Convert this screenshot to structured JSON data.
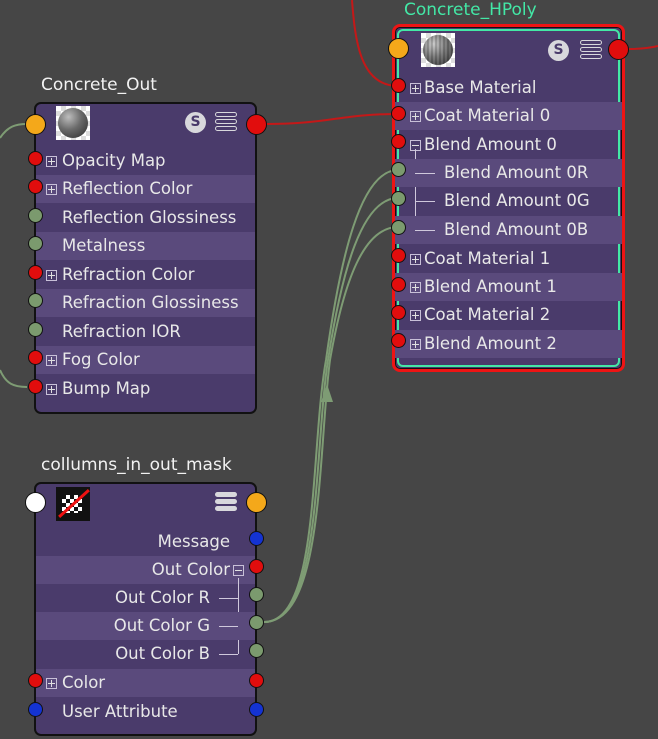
{
  "nodes": {
    "concrete_out": {
      "title": "Concrete_Out",
      "attributes": [
        {
          "label": "Opacity Map",
          "expander": "plus",
          "plug": "red"
        },
        {
          "label": "Reflection Color",
          "expander": "plus",
          "plug": "red"
        },
        {
          "label": "Reflection Glossiness",
          "expander": "",
          "plug": "green"
        },
        {
          "label": "Metalness",
          "expander": "",
          "plug": "green"
        },
        {
          "label": "Refraction Color",
          "expander": "plus",
          "plug": "red"
        },
        {
          "label": "Refraction Glossiness",
          "expander": "",
          "plug": "green"
        },
        {
          "label": "Refraction IOR",
          "expander": "",
          "plug": "green"
        },
        {
          "label": "Fog Color",
          "expander": "plus",
          "plug": "red"
        },
        {
          "label": "Bump Map",
          "expander": "plus",
          "plug": "red"
        }
      ],
      "header_icons": [
        "material-sphere-icon",
        "s-icon",
        "menu-icon"
      ]
    },
    "concrete_hpoly": {
      "title": "Concrete_HPoly",
      "attributes": [
        {
          "label": "Base Material",
          "expander": "plus",
          "plug": "red"
        },
        {
          "label": "Coat Material 0",
          "expander": "plus",
          "plug": "red"
        },
        {
          "label": "Blend Amount 0",
          "expander": "minus",
          "plug": "red"
        },
        {
          "label": "Blend Amount 0R",
          "expander": "",
          "plug": "green"
        },
        {
          "label": "Blend Amount 0G",
          "expander": "",
          "plug": "green"
        },
        {
          "label": "Blend Amount 0B",
          "expander": "",
          "plug": "green"
        },
        {
          "label": "Coat Material 1",
          "expander": "plus",
          "plug": "red"
        },
        {
          "label": "Blend Amount 1",
          "expander": "plus",
          "plug": "red"
        },
        {
          "label": "Coat Material 2",
          "expander": "plus",
          "plug": "red"
        },
        {
          "label": "Blend Amount 2",
          "expander": "plus",
          "plug": "red"
        }
      ],
      "header_icons": [
        "material-sphere-icon",
        "s-icon",
        "menu-icon"
      ]
    },
    "columns_mask": {
      "title": "collumns_in_out_mask",
      "attributes": [
        {
          "label": "Message",
          "plug": "blue"
        },
        {
          "label": "Out Color",
          "plug": "red"
        },
        {
          "label": "Out Color R",
          "plug": "green"
        },
        {
          "label": "Out Color G",
          "plug": "green"
        },
        {
          "label": "Out Color B",
          "plug": "green"
        },
        {
          "label": "Color",
          "plug": "red"
        },
        {
          "label": "User Attribute",
          "plug": "blue"
        }
      ],
      "header_icons": [
        "file-texture-icon",
        "menu-icon"
      ]
    }
  },
  "colors": {
    "background": "#464646",
    "node_body": "#4a3b6b",
    "node_row_alt": "#5a4a7c",
    "selected_title": "#43e8a6",
    "selection_outer": "#ee1414",
    "plug_red": "#e10d0d",
    "plug_green": "#7b9a6e",
    "plug_blue": "#1433d2",
    "plug_orange": "#f4a81a",
    "wire_red": "#c41818",
    "wire_green": "#7e9c74"
  },
  "s_icon_label": "S"
}
